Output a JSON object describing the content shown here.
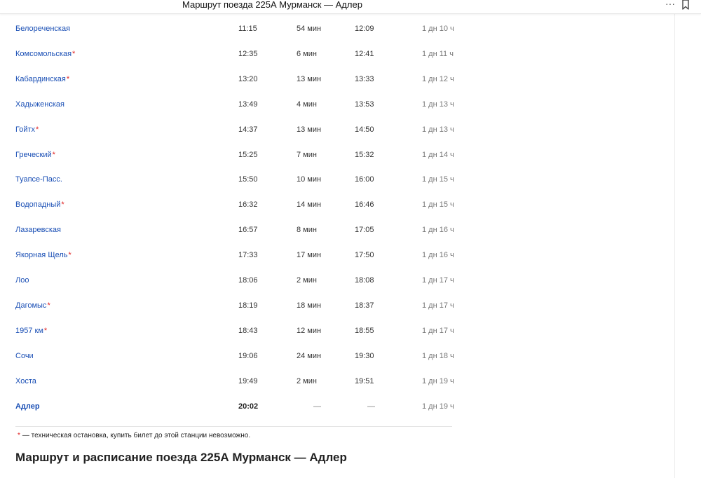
{
  "window": {
    "title": "Маршрут поезда 225А Мурманск — Адлер",
    "more_icon": "more-dots-icon",
    "bookmark_icon": "bookmark-icon"
  },
  "stops": [
    {
      "station": "Белореченская",
      "technical": false,
      "arrival": "11:15",
      "stop": "54 мин",
      "departure": "12:09",
      "travel": "1 дн 10 ч"
    },
    {
      "station": "Комсомольская",
      "technical": true,
      "arrival": "12:35",
      "stop": "6 мин",
      "departure": "12:41",
      "travel": "1 дн 11 ч"
    },
    {
      "station": "Кабардинская",
      "technical": true,
      "arrival": "13:20",
      "stop": "13 мин",
      "departure": "13:33",
      "travel": "1 дн 12 ч"
    },
    {
      "station": "Хадыженская",
      "technical": false,
      "arrival": "13:49",
      "stop": "4 мин",
      "departure": "13:53",
      "travel": "1 дн 13 ч"
    },
    {
      "station": "Гойтх",
      "technical": true,
      "arrival": "14:37",
      "stop": "13 мин",
      "departure": "14:50",
      "travel": "1 дн 13 ч"
    },
    {
      "station": "Греческий",
      "technical": true,
      "arrival": "15:25",
      "stop": "7 мин",
      "departure": "15:32",
      "travel": "1 дн 14 ч"
    },
    {
      "station": "Туапсе-Пасс.",
      "technical": false,
      "arrival": "15:50",
      "stop": "10 мин",
      "departure": "16:00",
      "travel": "1 дн 15 ч"
    },
    {
      "station": "Водопадный",
      "technical": true,
      "arrival": "16:32",
      "stop": "14 мин",
      "departure": "16:46",
      "travel": "1 дн 15 ч"
    },
    {
      "station": "Лазаревская",
      "technical": false,
      "arrival": "16:57",
      "stop": "8 мин",
      "departure": "17:05",
      "travel": "1 дн 16 ч"
    },
    {
      "station": "Якорная Щель",
      "technical": true,
      "arrival": "17:33",
      "stop": "17 мин",
      "departure": "17:50",
      "travel": "1 дн 16 ч"
    },
    {
      "station": "Лоо",
      "technical": false,
      "arrival": "18:06",
      "stop": "2 мин",
      "departure": "18:08",
      "travel": "1 дн 17 ч"
    },
    {
      "station": "Дагомыс",
      "technical": true,
      "arrival": "18:19",
      "stop": "18 мин",
      "departure": "18:37",
      "travel": "1 дн 17 ч"
    },
    {
      "station": "1957 км",
      "technical": true,
      "arrival": "18:43",
      "stop": "12 мин",
      "departure": "18:55",
      "travel": "1 дн 17 ч"
    },
    {
      "station": "Сочи",
      "technical": false,
      "arrival": "19:06",
      "stop": "24 мин",
      "departure": "19:30",
      "travel": "1 дн 18 ч"
    },
    {
      "station": "Хоста",
      "technical": false,
      "arrival": "19:49",
      "stop": "2 мин",
      "departure": "19:51",
      "travel": "1 дн 19 ч"
    },
    {
      "station": "Адлер",
      "technical": false,
      "arrival": "20:02",
      "stop": "—",
      "departure": "—",
      "travel": "1 дн 19 ч",
      "last": true
    }
  ],
  "footnote": {
    "mark": "*",
    "text": "— техническая остановка, купить билет до этой станции невозможно."
  },
  "section": {
    "heading": "Маршрут и расписание поезда 225А Мурманск — Адлер"
  },
  "colors": {
    "link": "#1a4fb5",
    "technical_mark": "#e02020",
    "divider": "#e4e4e4"
  }
}
